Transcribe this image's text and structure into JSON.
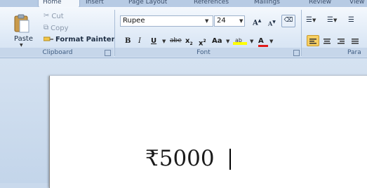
{
  "tabs": [
    "Home",
    "Insert",
    "Page Layout",
    "References",
    "Mailings",
    "Review",
    "View"
  ],
  "clipboard": {
    "paste_label": "Paste",
    "cut_label": "Cut",
    "copy_label": "Copy",
    "format_painter_label": "Format Painter",
    "group_label": "Clipboard"
  },
  "font": {
    "font_name": "Rupee",
    "font_size": "24",
    "group_label": "Font",
    "bold_label": "B",
    "italic_label": "I",
    "underline_label": "U",
    "strike_label": "abe",
    "subscript_label": "x",
    "superscript_label": "x",
    "case_label": "Aa",
    "grow_label": "A",
    "shrink_label": "A"
  },
  "paragraph": {
    "group_label": "Para"
  },
  "document": {
    "text": "₹5000"
  },
  "colors": {
    "highlight": "#ffff00",
    "font_color": "#e01b1b",
    "accent": "#f2c64a"
  }
}
